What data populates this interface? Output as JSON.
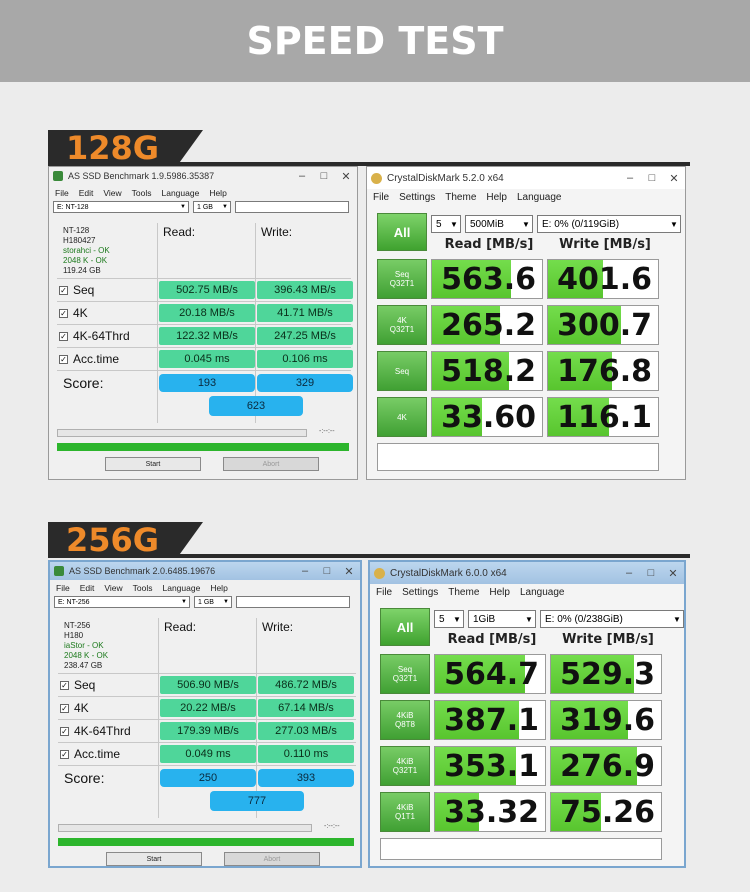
{
  "banner": {
    "title": "SPEED TEST"
  },
  "sections": [
    {
      "tag": "128G",
      "asssd": {
        "title": "AS SSD Benchmark 1.9.5986.35387",
        "menu": [
          "File",
          "Edit",
          "View",
          "Tools",
          "Language",
          "Help"
        ],
        "drive_select": "E: NT-128",
        "size_select": "1 GB",
        "info": [
          "NT-128",
          "H180427",
          "storahci - OK",
          "2048 K - OK",
          "119.24 GB"
        ],
        "read_head": "Read:",
        "write_head": "Write:",
        "rows": [
          {
            "label": "Seq",
            "read": "502.75 MB/s",
            "write": "396.43 MB/s"
          },
          {
            "label": "4K",
            "read": "20.18 MB/s",
            "write": "41.71 MB/s"
          },
          {
            "label": "4K-64Thrd",
            "read": "122.32 MB/s",
            "write": "247.25 MB/s"
          },
          {
            "label": "Acc.time",
            "read": "0.045 ms",
            "write": "0.106 ms"
          }
        ],
        "score_label": "Score:",
        "score_read": "193",
        "score_write": "329",
        "score_total": "623",
        "timer": "-:--:--",
        "start": "Start",
        "abort": "Abort"
      },
      "cdm": {
        "title": "CrystalDiskMark 5.2.0 x64",
        "menu": [
          "File",
          "Settings",
          "Theme",
          "Help",
          "Language"
        ],
        "all": "All",
        "count": "5",
        "size": "500MiB",
        "drive": "E: 0% (0/119GiB)",
        "read_head": "Read [MB/s]",
        "write_head": "Write [MB/s]",
        "rows": [
          {
            "label": "Seq\nQ32T1",
            "read": "563.6",
            "write": "401.6",
            "read_fill": 0.72,
            "write_fill": 0.5
          },
          {
            "label": "4K\nQ32T1",
            "read": "265.2",
            "write": "300.7",
            "read_fill": 0.62,
            "write_fill": 0.66
          },
          {
            "label": "Seq",
            "read": "518.2",
            "write": "176.8",
            "read_fill": 0.7,
            "write_fill": 0.58
          },
          {
            "label": "4K",
            "read": "33.60",
            "write": "116.1",
            "read_fill": 0.45,
            "write_fill": 0.55
          }
        ]
      }
    },
    {
      "tag": "256G",
      "asssd": {
        "title": "AS SSD Benchmark 2.0.6485.19676",
        "menu": [
          "File",
          "Edit",
          "View",
          "Tools",
          "Language",
          "Help"
        ],
        "drive_select": "E: NT-256",
        "size_select": "1 GB",
        "info": [
          "NT-256",
          "H180",
          "iaStor - OK",
          "2048 K - OK",
          "238.47 GB"
        ],
        "read_head": "Read:",
        "write_head": "Write:",
        "rows": [
          {
            "label": "Seq",
            "read": "506.90 MB/s",
            "write": "486.72 MB/s"
          },
          {
            "label": "4K",
            "read": "20.22 MB/s",
            "write": "67.14 MB/s"
          },
          {
            "label": "4K-64Thrd",
            "read": "179.39 MB/s",
            "write": "277.03 MB/s"
          },
          {
            "label": "Acc.time",
            "read": "0.049 ms",
            "write": "0.110 ms"
          }
        ],
        "score_label": "Score:",
        "score_read": "250",
        "score_write": "393",
        "score_total": "777",
        "timer": "-:--:--",
        "start": "Start",
        "abort": "Abort"
      },
      "cdm": {
        "title": "CrystalDiskMark 6.0.0 x64",
        "menu": [
          "File",
          "Settings",
          "Theme",
          "Help",
          "Language"
        ],
        "all": "All",
        "count": "5",
        "size": "1GiB",
        "drive": "E: 0% (0/238GiB)",
        "read_head": "Read [MB/s]",
        "write_head": "Write [MB/s]",
        "rows": [
          {
            "label": "Seq\nQ32T1",
            "read": "564.7",
            "write": "529.3",
            "read_fill": 0.82,
            "write_fill": 0.75
          },
          {
            "label": "4KiB\nQ8T8",
            "read": "387.1",
            "write": "319.6",
            "read_fill": 0.76,
            "write_fill": 0.7
          },
          {
            "label": "4KiB\nQ32T1",
            "read": "353.1",
            "write": "276.9",
            "read_fill": 0.74,
            "write_fill": 0.78
          },
          {
            "label": "4KiB\nQ1T1",
            "read": "33.32",
            "write": "75.26",
            "read_fill": 0.4,
            "write_fill": 0.45
          }
        ]
      }
    }
  ]
}
